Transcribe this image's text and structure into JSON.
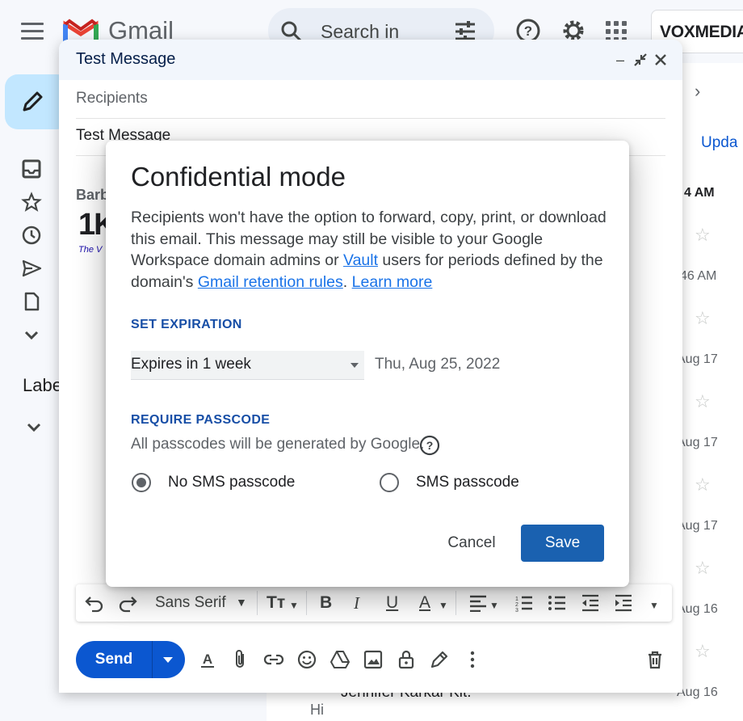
{
  "gmail": {
    "app_name": "Gmail",
    "search_placeholder": "Search in",
    "brand": "VOXMEDIA",
    "labels_heading": "Labe",
    "tab_partial": "Upda",
    "mail_times": [
      "4 AM",
      "46 AM",
      "Aug 17",
      "Aug 17",
      "Aug 17",
      "Aug 16",
      "Aug 16"
    ],
    "bottom_row_sender": "Jennifer Karkar Kit.",
    "bottom_row_snippet": "Hi"
  },
  "compose": {
    "title": "Test Message",
    "recipients_placeholder": "Recipients",
    "subject": "Test Message",
    "signature_name": "Barb",
    "signature_logo": "1K",
    "signature_tagline": "The V",
    "font_name": "Sans Serif",
    "send_label": "Send"
  },
  "dialog": {
    "title": "Confidential mode",
    "desc_part1": "Recipients won't have the option to forward, copy, print, or download this email. This message may still be visible to your Google Workspace domain admins or ",
    "vault_link": "Vault",
    "desc_part2": " users for periods defined by the domain's ",
    "retention_link": "Gmail retention rules",
    "desc_part3": ". ",
    "learn_more": "Learn more",
    "expiration_heading": "SET EXPIRATION",
    "expiration_value": "Expires in 1 week",
    "expiration_date": "Thu, Aug 25, 2022",
    "passcode_heading": "REQUIRE PASSCODE",
    "passcode_note": "All passcodes will be generated by Google.",
    "option_no_sms": "No SMS passcode",
    "option_sms": "SMS passcode",
    "selected_option": "No SMS passcode",
    "cancel_label": "Cancel",
    "save_label": "Save"
  },
  "colors": {
    "primary_blue": "#0b57d0",
    "save_blue": "#1a61b0",
    "link_blue": "#1a73e8",
    "section_heading": "#174ea6"
  }
}
